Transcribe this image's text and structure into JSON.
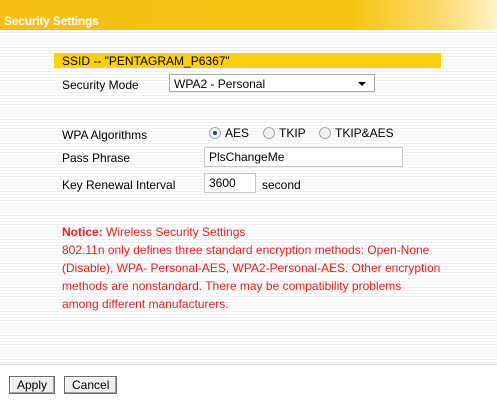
{
  "header": {
    "title": "Security Settings"
  },
  "ssid": {
    "text": "SSID -- \"PENTAGRAM_P6367\""
  },
  "security_mode": {
    "label": "Security Mode",
    "value": "WPA2 - Personal"
  },
  "wpa_algorithms": {
    "label": "WPA Algorithms",
    "options": [
      {
        "label": "AES",
        "selected": true
      },
      {
        "label": "TKIP",
        "selected": false
      },
      {
        "label": "TKIP&AES",
        "selected": false
      }
    ]
  },
  "pass_phrase": {
    "label": "Pass Phrase",
    "value": "PlsChangeMe"
  },
  "key_renewal": {
    "label": "Key Renewal Interval",
    "value": "3600",
    "unit": "second"
  },
  "notice": {
    "title": "Notice:",
    "subtitle": "Wireless Security Settings",
    "lines": [
      "802.11n only defines three standard encryption methods: Open-None",
      "(Disable), WPA- Personal-AES, WPA2-Personal-AES. Other encryption",
      "methods are nonstandard. There may be compatibility problems",
      "among different manufacturers."
    ]
  },
  "footer": {
    "apply_label": "Apply",
    "cancel_label": "Cancel"
  },
  "colors": {
    "header": "#f6bf12",
    "ssid_bar": "#fbd10d",
    "notice": "#e51e1e"
  }
}
